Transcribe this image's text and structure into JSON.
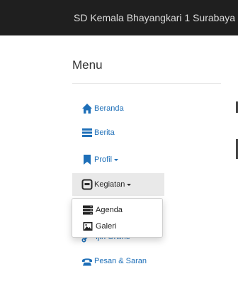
{
  "header": {
    "brand": "SD Kemala Bhayangkari 1 Surabaya"
  },
  "sidebar": {
    "title": "Menu",
    "items": [
      {
        "label": "Beranda",
        "icon": "home-icon"
      },
      {
        "label": "Berita",
        "icon": "list-icon"
      },
      {
        "label": "Profil",
        "icon": "bookmark-icon",
        "dropdown": true
      },
      {
        "label": "Kegiatan",
        "icon": "box-icon",
        "dropdown": true,
        "active": true
      },
      {
        "label": "Ijin Online",
        "icon": "link-icon"
      },
      {
        "label": "Pesan & Saran",
        "icon": "phone-icon"
      }
    ]
  },
  "dropdown": {
    "items": [
      {
        "label": "Agenda",
        "icon": "server-icon"
      },
      {
        "label": "Galeri",
        "icon": "image-icon"
      }
    ]
  },
  "colors": {
    "topbar": "#1f1f1f",
    "link": "#1e6fb8",
    "active_bg": "#e9e9e9"
  }
}
